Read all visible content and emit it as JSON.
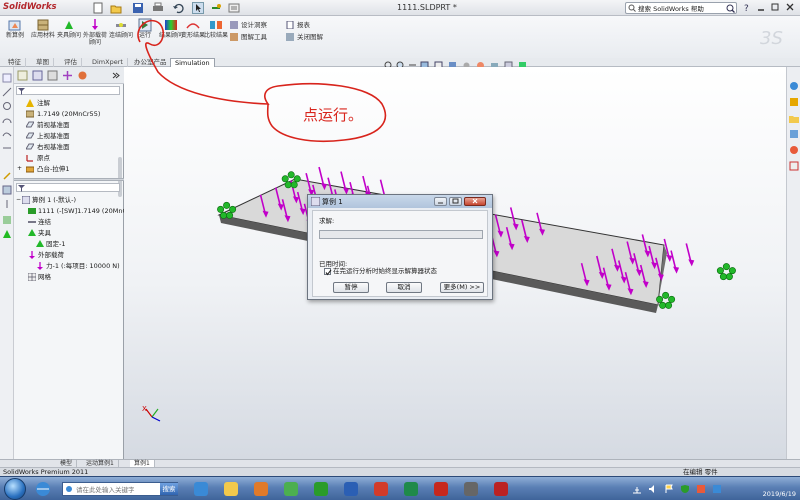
{
  "titlebar": {
    "app_name": "SolidWorks",
    "document_title": "1111.SLDPRT *",
    "search_value": "搜索 SolidWorks 帮助"
  },
  "commands": {
    "large": [
      {
        "label": "新算例",
        "icon": "new-study-icon"
      },
      {
        "label": "应用材料",
        "icon": "apply-material-icon"
      },
      {
        "label": "夹具顾问",
        "icon": "fixture-advisor-icon"
      },
      {
        "label": "外部载荷顾问",
        "icon": "load-advisor-icon"
      },
      {
        "label": "连结顾问",
        "icon": "connections-advisor-icon"
      },
      {
        "label": "运行",
        "icon": "run-icon"
      },
      {
        "label": "结果顾问",
        "icon": "results-advisor-icon"
      },
      {
        "label": "变形结果",
        "icon": "deformed-result-icon"
      },
      {
        "label": "比较结果",
        "icon": "compare-results-icon"
      }
    ],
    "small": [
      {
        "label": "设计洞察",
        "icon": "design-insight-icon"
      },
      {
        "label": "图解工具",
        "icon": "plot-tools-icon"
      },
      {
        "label": "报表",
        "icon": "report-icon"
      },
      {
        "label": "关闭图解",
        "icon": "close-plot-icon"
      }
    ]
  },
  "tabs": [
    "特征",
    "草图",
    "评估",
    "DimXpert",
    "办公室产品",
    "Simulation"
  ],
  "feature_tree": {
    "items": [
      {
        "label": "注解",
        "icon": "annotations-icon"
      },
      {
        "label": "1.7149 (20MnCr55)",
        "icon": "material-icon"
      },
      {
        "label": "前视基准面",
        "icon": "plane-icon"
      },
      {
        "label": "上视基准面",
        "icon": "plane-icon"
      },
      {
        "label": "右视基准面",
        "icon": "plane-icon"
      },
      {
        "label": "原点",
        "icon": "origin-icon"
      },
      {
        "label": "凸台-拉伸1",
        "icon": "extrude-icon"
      }
    ],
    "study_items": [
      {
        "label": "算例 1 (-默认-)",
        "icon": "study-icon"
      },
      {
        "label": "1111 (-[SW]1.7149 (20MnCr",
        "icon": "part-icon"
      },
      {
        "label": "连结",
        "icon": "connections-icon"
      },
      {
        "label": "夹具",
        "icon": "fixtures-icon"
      },
      {
        "label": "固定-1",
        "icon": "fixed-icon"
      },
      {
        "label": "外部载荷",
        "icon": "external-loads-icon"
      },
      {
        "label": "力-1 (:每项目: 10000 N)",
        "icon": "force-icon"
      },
      {
        "label": "网格",
        "icon": "mesh-icon"
      }
    ]
  },
  "dialog": {
    "title": "算例 1",
    "solve_label": "求解:",
    "progress": 0,
    "elapsed_label": "已用时间:",
    "checkbox_label": "在完运行分析时始终显示解算器状态",
    "checkbox_checked": true,
    "buttons": {
      "pause": "暂停",
      "cancel": "取消",
      "more": "更多(M) >>"
    }
  },
  "annotation": {
    "text": "点运行。",
    "color": "#d8241c"
  },
  "bottom_tabs": [
    "模型",
    "运动算例1",
    "算例1"
  ],
  "status": {
    "left": "SolidWorks Premium 2011",
    "right": "在编辑 零件"
  },
  "taskbar": {
    "search_placeholder": "请在此处输入关键字",
    "search_button": "搜索",
    "date": "2019/6/19",
    "apps": [
      "ie-icon",
      "folder-icon",
      "media-player-icon",
      "chrome-icon",
      "player-icon",
      "word-icon",
      "wps-icon",
      "excel-icon",
      "solidworks-icon",
      "app-icon",
      "sw-task-icon"
    ]
  },
  "colors": {
    "force_arrow": "#c100c9",
    "fixture": "#22b82a",
    "plate": "#d9d9d9"
  }
}
